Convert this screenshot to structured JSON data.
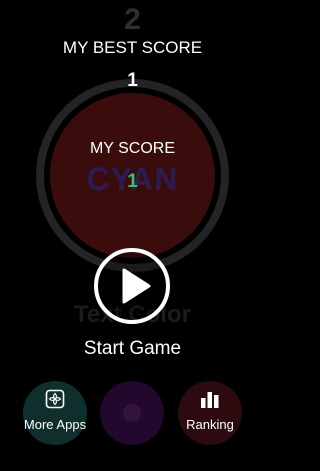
{
  "background_level": "2",
  "best": {
    "label": "MY BEST SCORE",
    "value": "1"
  },
  "current": {
    "label": "MY SCORE",
    "color_word": "CYAN",
    "value": "1"
  },
  "mode_text": "Text Color",
  "start": {
    "label": "Start Game",
    "icon": "play-icon"
  },
  "bottom_bar": {
    "more_apps": {
      "label": "More Apps",
      "icon": "apps-icon"
    },
    "middle": {
      "label": "",
      "icon": "circle-icon"
    },
    "ranking": {
      "label": "Ranking",
      "icon": "bar-chart-icon"
    }
  },
  "colors": {
    "background": "#000000",
    "dial": "#3a0c0c",
    "score_value": "#3fc06a",
    "color_word": "#2d1c52",
    "more_apps_button": "#0f2f2d",
    "middle_button": "#22082c",
    "ranking_button": "#2c0a0e"
  }
}
